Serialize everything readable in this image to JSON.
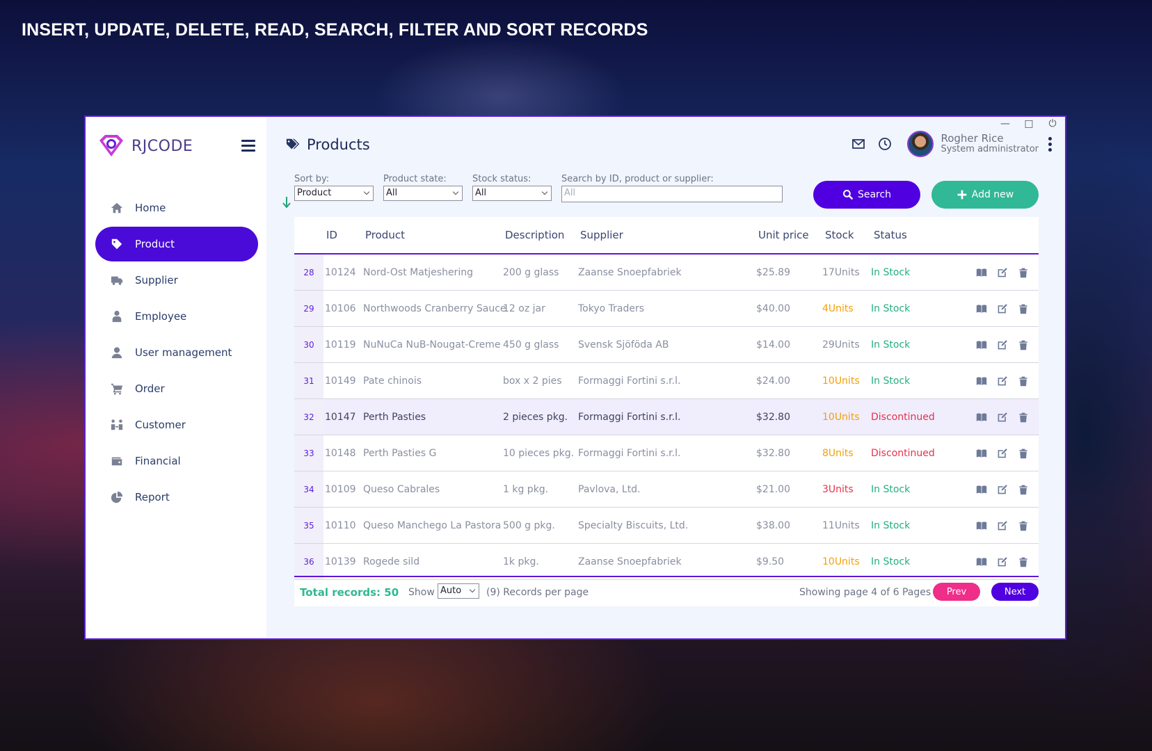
{
  "headline": "INSERT, UPDATE, DELETE, READ, SEARCH, FILTER AND SORT RECORDS",
  "app": {
    "logo_text": "RJCODE"
  },
  "sidebar": {
    "items": [
      {
        "label": "Home",
        "icon": "home-icon",
        "active": false
      },
      {
        "label": "Product",
        "icon": "tag-icon",
        "active": true
      },
      {
        "label": "Supplier",
        "icon": "truck-icon",
        "active": false
      },
      {
        "label": "Employee",
        "icon": "employee-icon",
        "active": false
      },
      {
        "label": "User management",
        "icon": "user-icon",
        "active": false
      },
      {
        "label": "Order",
        "icon": "cart-icon",
        "active": false
      },
      {
        "label": "Customer",
        "icon": "customer-icon",
        "active": false
      },
      {
        "label": "Financial",
        "icon": "wallet-icon",
        "active": false
      },
      {
        "label": "Report",
        "icon": "pie-chart-icon",
        "active": false
      }
    ]
  },
  "header": {
    "title": "Products",
    "user_name": "Rogher Rice",
    "user_role": "System administrator"
  },
  "filters": {
    "sort_label": "Sort by:",
    "sort_value": "Product",
    "state_label": "Product state:",
    "state_value": "All",
    "stock_label": "Stock status:",
    "stock_value": "All",
    "search_label": "Search by ID, product or supplier:",
    "search_placeholder": "All",
    "search_button": "Search",
    "add_button": "Add new"
  },
  "table": {
    "columns": [
      "ID",
      "Product",
      "Description",
      "Supplier",
      "Unit price",
      "Stock",
      "Status"
    ],
    "rows": [
      {
        "num": "28",
        "id": "10124",
        "product": "Nord-Ost Matjeshering",
        "description": "200 g glass",
        "supplier": "Zaanse Snoepfabriek",
        "price": "$25.89",
        "stock": "17Units",
        "stock_level": "ok",
        "status": "In Stock",
        "status_kind": "in"
      },
      {
        "num": "29",
        "id": "10106",
        "product": "Northwoods Cranberry Sauce",
        "description": "12 oz jar",
        "supplier": "Tokyo Traders",
        "price": "$40.00",
        "stock": "4Units",
        "stock_level": "low",
        "status": "In Stock",
        "status_kind": "in"
      },
      {
        "num": "30",
        "id": "10119",
        "product": "NuNuCa NuB-Nougat-Creme",
        "description": "450 g glass",
        "supplier": "Svensk Sjöföda AB",
        "price": "$14.00",
        "stock": "29Units",
        "stock_level": "ok",
        "status": "In Stock",
        "status_kind": "in"
      },
      {
        "num": "31",
        "id": "10149",
        "product": "Pate chinois",
        "description": "box x 2 pies",
        "supplier": "Formaggi Fortini s.r.l.",
        "price": "$24.00",
        "stock": "10Units",
        "stock_level": "low",
        "status": "In Stock",
        "status_kind": "in"
      },
      {
        "num": "32",
        "id": "10147",
        "product": "Perth Pasties",
        "description": "2 pieces pkg.",
        "supplier": "Formaggi Fortini s.r.l.",
        "price": "$32.80",
        "stock": "10Units",
        "stock_level": "low",
        "status": "Discontinued",
        "status_kind": "dis"
      },
      {
        "num": "33",
        "id": "10148",
        "product": "Perth Pasties G",
        "description": "10 pieces pkg.",
        "supplier": "Formaggi Fortini s.r.l.",
        "price": "$32.80",
        "stock": "8Units",
        "stock_level": "low",
        "status": "Discontinued",
        "status_kind": "dis"
      },
      {
        "num": "34",
        "id": "10109",
        "product": "Queso Cabrales",
        "description": "1 kg pkg.",
        "supplier": "Pavlova,  Ltd.",
        "price": "$21.00",
        "stock": "3Units",
        "stock_level": "crit",
        "status": "In Stock",
        "status_kind": "in"
      },
      {
        "num": "35",
        "id": "10110",
        "product": "Queso Manchego La Pastora",
        "description": "500 g pkg.",
        "supplier": "Specialty Biscuits,  Ltd.",
        "price": "$38.00",
        "stock": "11Units",
        "stock_level": "ok",
        "status": "In Stock",
        "status_kind": "in"
      },
      {
        "num": "36",
        "id": "10139",
        "product": "Rogede sild",
        "description": "1k pkg.",
        "supplier": "Zaanse Snoepfabriek",
        "price": "$9.50",
        "stock": "10Units",
        "stock_level": "low",
        "status": "In Stock",
        "status_kind": "in"
      }
    ]
  },
  "footer": {
    "total": "Total records: 50",
    "show_label": "Show",
    "show_value": "Auto",
    "records_per_page": "(9) Records per page",
    "page_info": "Showing page 4 of 6 Pages",
    "prev": "Prev",
    "next": "Next"
  },
  "colors": {
    "accent": "#5000e0",
    "add_button": "#31b896",
    "prev_button": "#ef2e8a",
    "in_stock": "#23b07c",
    "discontinued": "#e9304d",
    "low_stock": "#f3a007"
  }
}
